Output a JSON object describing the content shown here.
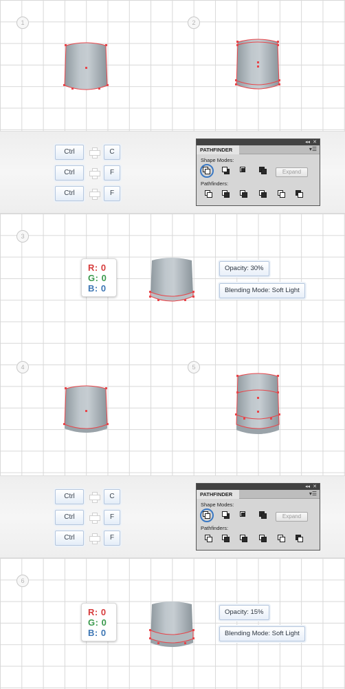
{
  "steps": {
    "s1": "1",
    "s2": "2",
    "s3": "3",
    "s4": "4",
    "s5": "5",
    "s6": "6"
  },
  "shortcuts": {
    "row1": {
      "modifier": "Ctrl",
      "key": "C"
    },
    "row2": {
      "modifier": "Ctrl",
      "key": "F"
    },
    "row3": {
      "modifier": "Ctrl",
      "key": "F"
    }
  },
  "pathfinder": {
    "title": "PATHFINDER",
    "shape_modes_label": "Shape Modes:",
    "pathfinders_label": "Pathfinders:",
    "expand_label": "Expand",
    "collapse_icon": "double-chevron-icon",
    "close_icon": "close-icon",
    "menu_icon": "panel-menu-icon",
    "highlighted_mode": "unite"
  },
  "fill_a": {
    "r_label": "R:",
    "r_value": "0",
    "g_label": "G:",
    "g_value": "0",
    "b_label": "B:",
    "b_value": "0",
    "opacity": "Opacity: 30%",
    "blending": "Blending Mode: Soft Light"
  },
  "fill_b": {
    "r_label": "R:",
    "r_value": "0",
    "g_label": "G:",
    "g_value": "0",
    "b_label": "B:",
    "b_value": "0",
    "opacity": "Opacity: 15%",
    "blending": "Blending Mode: Soft Light"
  },
  "colors": {
    "anchor": "#e8454a",
    "shape_light": "#c3cacf",
    "shape_dark": "#8d979e",
    "highlight_ring": "#3a78c3",
    "red_text": "#d63c3c",
    "green_text": "#3b9a4e",
    "blue_text": "#3d76b4"
  }
}
